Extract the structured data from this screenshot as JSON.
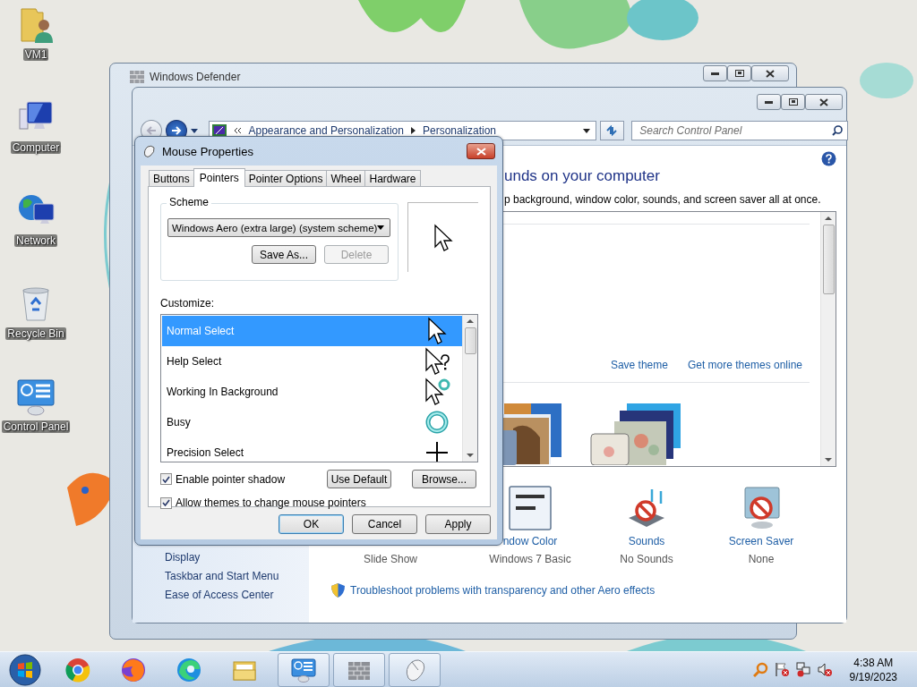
{
  "desktop_icons": [
    {
      "label": "VM1",
      "kind": "user-folder"
    },
    {
      "label": "Computer",
      "kind": "computer"
    },
    {
      "label": "Network",
      "kind": "network"
    },
    {
      "label": "Recycle Bin",
      "kind": "recycle-bin"
    },
    {
      "label": "Control Panel",
      "kind": "control-panel"
    }
  ],
  "background_window": {
    "title": "Windows Defender"
  },
  "control_panel": {
    "address": [
      "Appearance and Personalization",
      "Personalization"
    ],
    "search": {
      "placeholder": "Search Control Panel"
    },
    "heading": "unds on your computer",
    "description": "p background, window color, sounds, and screen saver all at once.",
    "theme_links": [
      "Save theme",
      "Get more themes online"
    ],
    "settings": [
      {
        "kind": "desktop-background",
        "value": "Slide Show"
      },
      {
        "kind": "window-color",
        "label": "ndow Color",
        "value": "Windows 7 Basic"
      },
      {
        "kind": "sounds",
        "label": "Sounds",
        "value": "No Sounds"
      },
      {
        "kind": "screen-saver",
        "label": "Screen Saver",
        "value": "None"
      }
    ],
    "troubleshoot_link": "Troubleshoot problems with transparency and other Aero effects",
    "see_also": [
      "Display",
      "Taskbar and Start Menu",
      "Ease of Access Center"
    ]
  },
  "mouse_properties": {
    "title": "Mouse Properties",
    "tabs": [
      {
        "label": "Buttons",
        "selected": false
      },
      {
        "label": "Pointers",
        "selected": true
      },
      {
        "label": "Pointer Options",
        "selected": false
      },
      {
        "label": "Wheel",
        "selected": false
      },
      {
        "label": "Hardware",
        "selected": false
      }
    ],
    "scheme": {
      "label": "Scheme",
      "value": "Windows Aero (extra large) (system scheme)",
      "buttons": [
        {
          "label": "Save As...",
          "disabled": false
        },
        {
          "label": "Delete",
          "disabled": true
        }
      ]
    },
    "customize_label": "Customize:",
    "pointers": [
      {
        "name": "Normal Select",
        "kind": "arrow",
        "selected": true
      },
      {
        "name": "Help Select",
        "kind": "help",
        "selected": false
      },
      {
        "name": "Working In Background",
        "kind": "working",
        "selected": false
      },
      {
        "name": "Busy",
        "kind": "busy",
        "selected": false
      },
      {
        "name": "Precision Select",
        "kind": "cross",
        "selected": false
      }
    ],
    "options": [
      {
        "label": "Enable pointer shadow",
        "checked": true
      },
      {
        "label": "Allow themes to change mouse pointers",
        "checked": true
      }
    ],
    "list_buttons": [
      "Use Default",
      "Browse..."
    ],
    "buttons": [
      {
        "label": "OK",
        "default": true
      },
      {
        "label": "Cancel",
        "default": false
      },
      {
        "label": "Apply",
        "default": false
      }
    ]
  },
  "taskbar": {
    "items": [
      {
        "kind": "globe-browser",
        "running": false
      },
      {
        "kind": "fox-browser",
        "running": false
      },
      {
        "kind": "wave-browser",
        "running": false
      },
      {
        "kind": "folders",
        "running": false
      },
      {
        "kind": "control-panel",
        "running": true
      },
      {
        "kind": "brick-wall",
        "running": true
      },
      {
        "kind": "mouse",
        "running": true
      }
    ],
    "clock": {
      "time": "4:38 AM",
      "date": "9/19/2023"
    }
  }
}
